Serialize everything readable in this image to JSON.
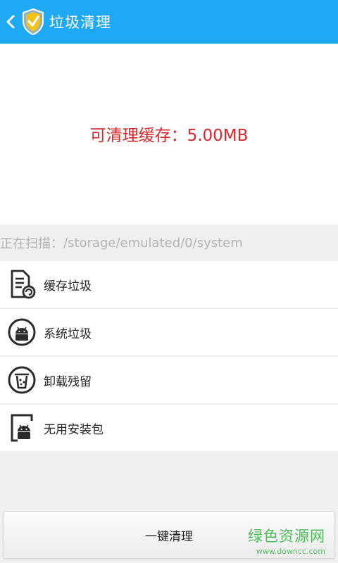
{
  "header": {
    "title": "垃圾清理",
    "accent": "#1fa8f3"
  },
  "hero": {
    "label": "可清理缓存：",
    "value": "5.00MB",
    "color": "#d9262b"
  },
  "scan": {
    "label": "正在扫描：",
    "path": " /storage/emulated/0/system"
  },
  "list": {
    "items": [
      {
        "label": "缓存垃圾",
        "icon": "cache-file-icon"
      },
      {
        "label": "系统垃圾",
        "icon": "android-system-icon"
      },
      {
        "label": "卸载残留",
        "icon": "uninstall-residue-icon"
      },
      {
        "label": "无用安装包",
        "icon": "apk-package-icon"
      }
    ]
  },
  "actions": {
    "clean_label": "一键清理"
  },
  "watermark": {
    "cn": "绿色资源网",
    "en": "www.downcc.com"
  }
}
